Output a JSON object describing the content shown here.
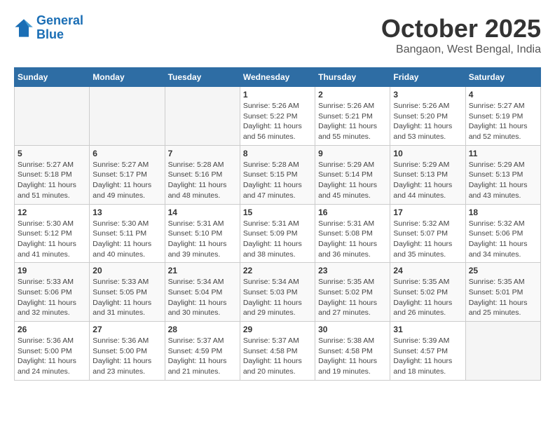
{
  "header": {
    "logo_line1": "General",
    "logo_line2": "Blue",
    "month": "October 2025",
    "location": "Bangaon, West Bengal, India"
  },
  "weekdays": [
    "Sunday",
    "Monday",
    "Tuesday",
    "Wednesday",
    "Thursday",
    "Friday",
    "Saturday"
  ],
  "weeks": [
    [
      {
        "day": "",
        "info": ""
      },
      {
        "day": "",
        "info": ""
      },
      {
        "day": "",
        "info": ""
      },
      {
        "day": "1",
        "info": "Sunrise: 5:26 AM\nSunset: 5:22 PM\nDaylight: 11 hours and 56 minutes."
      },
      {
        "day": "2",
        "info": "Sunrise: 5:26 AM\nSunset: 5:21 PM\nDaylight: 11 hours and 55 minutes."
      },
      {
        "day": "3",
        "info": "Sunrise: 5:26 AM\nSunset: 5:20 PM\nDaylight: 11 hours and 53 minutes."
      },
      {
        "day": "4",
        "info": "Sunrise: 5:27 AM\nSunset: 5:19 PM\nDaylight: 11 hours and 52 minutes."
      }
    ],
    [
      {
        "day": "5",
        "info": "Sunrise: 5:27 AM\nSunset: 5:18 PM\nDaylight: 11 hours and 51 minutes."
      },
      {
        "day": "6",
        "info": "Sunrise: 5:27 AM\nSunset: 5:17 PM\nDaylight: 11 hours and 49 minutes."
      },
      {
        "day": "7",
        "info": "Sunrise: 5:28 AM\nSunset: 5:16 PM\nDaylight: 11 hours and 48 minutes."
      },
      {
        "day": "8",
        "info": "Sunrise: 5:28 AM\nSunset: 5:15 PM\nDaylight: 11 hours and 47 minutes."
      },
      {
        "day": "9",
        "info": "Sunrise: 5:29 AM\nSunset: 5:14 PM\nDaylight: 11 hours and 45 minutes."
      },
      {
        "day": "10",
        "info": "Sunrise: 5:29 AM\nSunset: 5:13 PM\nDaylight: 11 hours and 44 minutes."
      },
      {
        "day": "11",
        "info": "Sunrise: 5:29 AM\nSunset: 5:13 PM\nDaylight: 11 hours and 43 minutes."
      }
    ],
    [
      {
        "day": "12",
        "info": "Sunrise: 5:30 AM\nSunset: 5:12 PM\nDaylight: 11 hours and 41 minutes."
      },
      {
        "day": "13",
        "info": "Sunrise: 5:30 AM\nSunset: 5:11 PM\nDaylight: 11 hours and 40 minutes."
      },
      {
        "day": "14",
        "info": "Sunrise: 5:31 AM\nSunset: 5:10 PM\nDaylight: 11 hours and 39 minutes."
      },
      {
        "day": "15",
        "info": "Sunrise: 5:31 AM\nSunset: 5:09 PM\nDaylight: 11 hours and 38 minutes."
      },
      {
        "day": "16",
        "info": "Sunrise: 5:31 AM\nSunset: 5:08 PM\nDaylight: 11 hours and 36 minutes."
      },
      {
        "day": "17",
        "info": "Sunrise: 5:32 AM\nSunset: 5:07 PM\nDaylight: 11 hours and 35 minutes."
      },
      {
        "day": "18",
        "info": "Sunrise: 5:32 AM\nSunset: 5:06 PM\nDaylight: 11 hours and 34 minutes."
      }
    ],
    [
      {
        "day": "19",
        "info": "Sunrise: 5:33 AM\nSunset: 5:06 PM\nDaylight: 11 hours and 32 minutes."
      },
      {
        "day": "20",
        "info": "Sunrise: 5:33 AM\nSunset: 5:05 PM\nDaylight: 11 hours and 31 minutes."
      },
      {
        "day": "21",
        "info": "Sunrise: 5:34 AM\nSunset: 5:04 PM\nDaylight: 11 hours and 30 minutes."
      },
      {
        "day": "22",
        "info": "Sunrise: 5:34 AM\nSunset: 5:03 PM\nDaylight: 11 hours and 29 minutes."
      },
      {
        "day": "23",
        "info": "Sunrise: 5:35 AM\nSunset: 5:02 PM\nDaylight: 11 hours and 27 minutes."
      },
      {
        "day": "24",
        "info": "Sunrise: 5:35 AM\nSunset: 5:02 PM\nDaylight: 11 hours and 26 minutes."
      },
      {
        "day": "25",
        "info": "Sunrise: 5:35 AM\nSunset: 5:01 PM\nDaylight: 11 hours and 25 minutes."
      }
    ],
    [
      {
        "day": "26",
        "info": "Sunrise: 5:36 AM\nSunset: 5:00 PM\nDaylight: 11 hours and 24 minutes."
      },
      {
        "day": "27",
        "info": "Sunrise: 5:36 AM\nSunset: 5:00 PM\nDaylight: 11 hours and 23 minutes."
      },
      {
        "day": "28",
        "info": "Sunrise: 5:37 AM\nSunset: 4:59 PM\nDaylight: 11 hours and 21 minutes."
      },
      {
        "day": "29",
        "info": "Sunrise: 5:37 AM\nSunset: 4:58 PM\nDaylight: 11 hours and 20 minutes."
      },
      {
        "day": "30",
        "info": "Sunrise: 5:38 AM\nSunset: 4:58 PM\nDaylight: 11 hours and 19 minutes."
      },
      {
        "day": "31",
        "info": "Sunrise: 5:39 AM\nSunset: 4:57 PM\nDaylight: 11 hours and 18 minutes."
      },
      {
        "day": "",
        "info": ""
      }
    ]
  ]
}
